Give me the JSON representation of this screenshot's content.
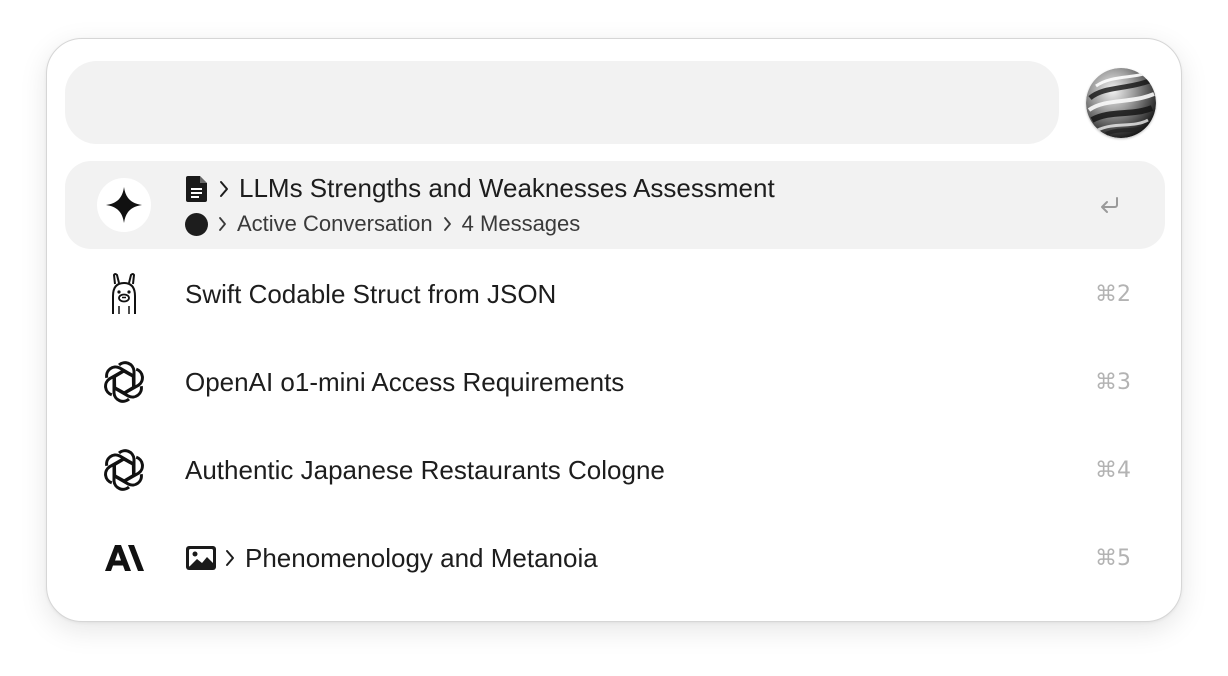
{
  "search": {
    "value": "",
    "placeholder": ""
  },
  "avatar": {
    "icon": "marble-sphere-avatar"
  },
  "results": [
    {
      "app_icon": "sparkle-icon",
      "type_icon": "document-icon",
      "title": "LLMs Strengths and Weaknesses Assessment",
      "status_icon": "filled-circle-icon",
      "status": "Active Conversation",
      "detail": "4 Messages",
      "action_icon": "return-key-icon",
      "selected": true
    },
    {
      "app_icon": "llama-icon",
      "title": "Swift Codable Struct from JSON",
      "shortcut": "⌘2"
    },
    {
      "app_icon": "openai-icon",
      "title": "OpenAI o1-mini Access Requirements",
      "shortcut": "⌘3"
    },
    {
      "app_icon": "openai-icon",
      "title": "Authentic Japanese Restaurants Cologne",
      "shortcut": "⌘4"
    },
    {
      "app_icon": "anthropic-icon",
      "type_icon": "image-icon",
      "title": "Phenomenology and Metanoia",
      "shortcut": "⌘5"
    }
  ]
}
